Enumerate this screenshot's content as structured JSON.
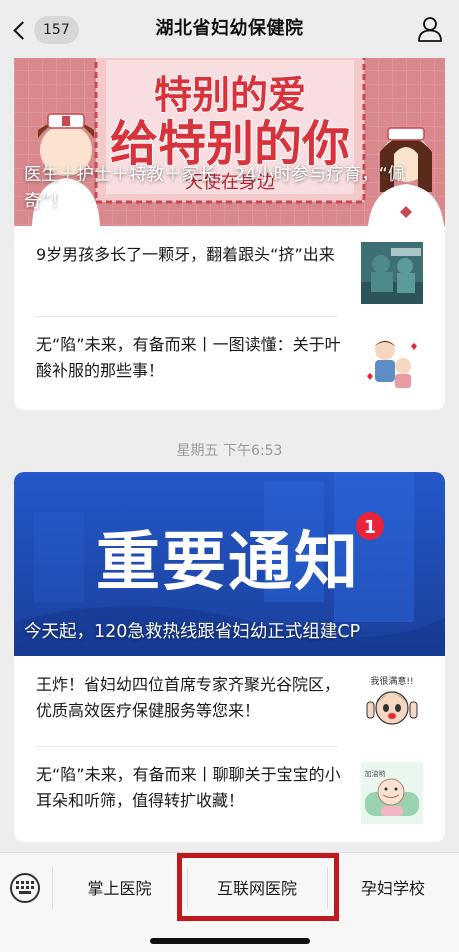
{
  "nav": {
    "unread_count": "157",
    "title": "湖北省妇幼保健院",
    "back_icon": "chevron-left-icon",
    "profile_icon": "person-icon"
  },
  "messages": [
    {
      "banner": {
        "headline_1": "特别的爱",
        "headline_2": "给特别的你",
        "tagline": "天使在身边",
        "caption": "医生＋护士＋特教＋家长，24小时参与疗育，“佩奇”！"
      },
      "articles": [
        {
          "title": "9岁男孩多长了一颗牙，翻着跟头“挤”出来"
        },
        {
          "title": "无“陷”未来，有备而来丨一图读懂：关于叶酸补服的那些事！"
        }
      ]
    },
    {
      "banner": {
        "headline": "重要通知",
        "badge": "1",
        "caption": "今天起，120急救热线跟省妇幼正式组建CP"
      },
      "articles": [
        {
          "title": "王炸！省妇幼四位首席专家齐聚光谷院区，优质高效医疗保健服务等您来！",
          "thumb_text": "我很满意!!"
        },
        {
          "title": "无“陷”未来，有备而来丨聊聊关于宝宝的小耳朵和听筛，值得转扩收藏！",
          "thumb_text": "加油哟"
        }
      ]
    }
  ],
  "timestamp": "星期五 下午6:53",
  "bottom_menu": {
    "toggle_icon": "keyboard-icon",
    "items": [
      {
        "label": "掌上医院"
      },
      {
        "label": "互联网医院"
      },
      {
        "label": "孕妇学校"
      }
    ],
    "highlight_color": "#c0191d"
  },
  "colors": {
    "banner_1_bg": "#d9898e",
    "banner_2_bg": "#2558c9",
    "badge_red": "#e8233a"
  }
}
